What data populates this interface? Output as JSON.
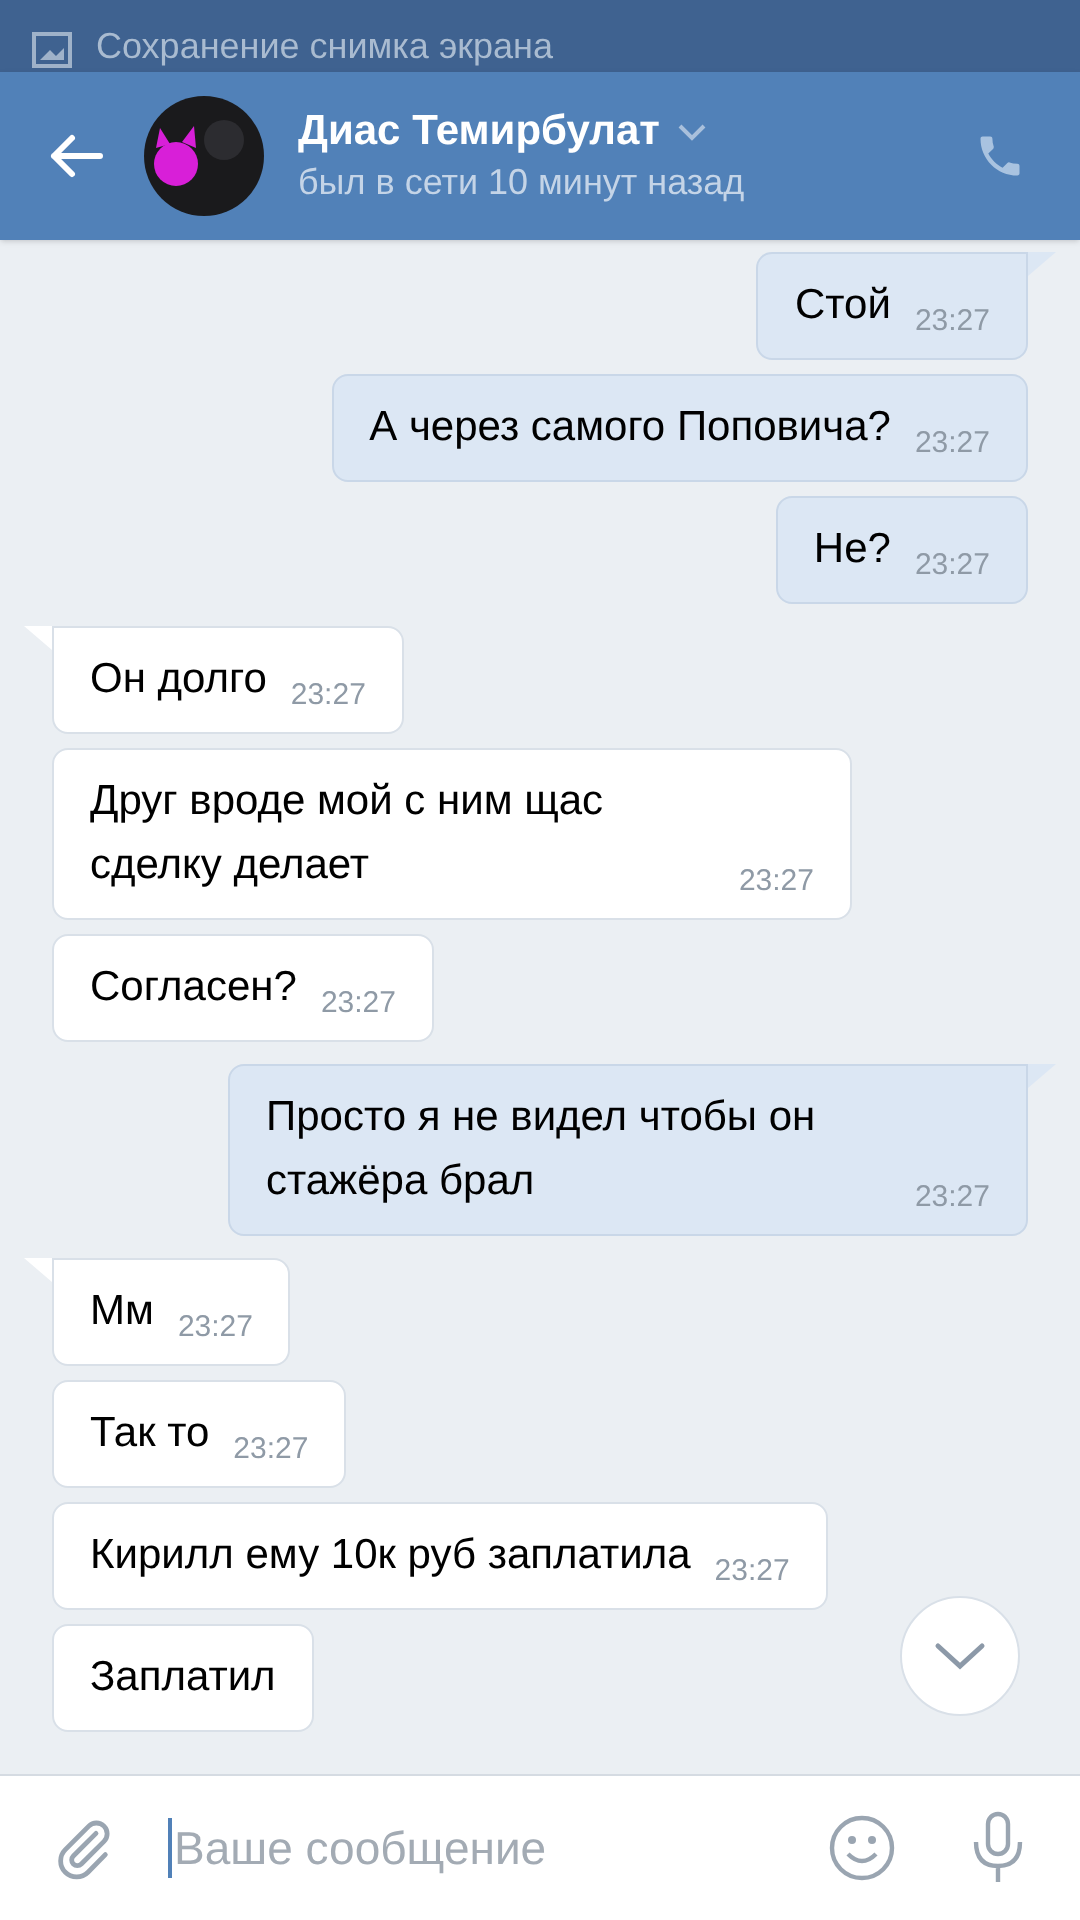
{
  "notification": {
    "text": "Сохранение снимка экрана"
  },
  "header": {
    "name": "Диас Темирбулат",
    "status": "был в сети 10 минут назад"
  },
  "messages": [
    {
      "kind": "out",
      "tail": true,
      "text": "Стой",
      "time": "23:27"
    },
    {
      "kind": "out",
      "tail": false,
      "text": "А через самого Поповича?",
      "time": "23:27"
    },
    {
      "kind": "out",
      "tail": false,
      "text": "Не?",
      "time": "23:27"
    },
    {
      "kind": "in",
      "tail": true,
      "text": "Он долго",
      "time": "23:27"
    },
    {
      "kind": "in",
      "tail": false,
      "text": "Друг вроде мой с ним щас сделку делает",
      "time": "23:27"
    },
    {
      "kind": "in",
      "tail": false,
      "text": "Согласен?",
      "time": "23:27"
    },
    {
      "kind": "out",
      "tail": true,
      "text": "Просто я не видел чтобы он стажёра брал",
      "time": "23:27"
    },
    {
      "kind": "in",
      "tail": true,
      "text": "Мм",
      "time": "23:27"
    },
    {
      "kind": "in",
      "tail": false,
      "text": "Так то",
      "time": "23:27"
    },
    {
      "kind": "in",
      "tail": false,
      "text": "Кирилл ему 10к руб заплатила",
      "time": "23:27"
    },
    {
      "kind": "in",
      "tail": false,
      "text": "Заплатил"
    }
  ],
  "composer": {
    "placeholder": "Ваше сообщение"
  }
}
